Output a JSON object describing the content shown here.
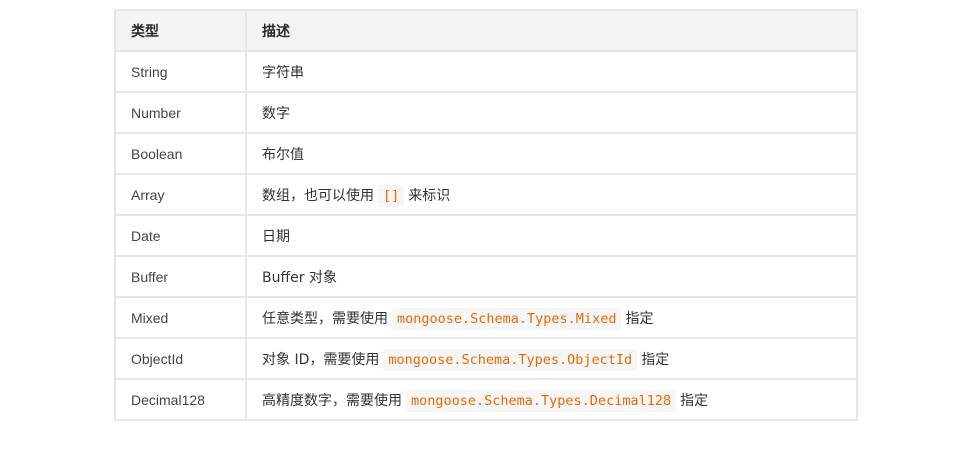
{
  "table": {
    "headers": [
      "类型",
      "描述"
    ],
    "code_color": "#e96900",
    "rows": [
      {
        "type": "String",
        "desc_pre": "字符串",
        "code": "",
        "desc_post": ""
      },
      {
        "type": "Number",
        "desc_pre": "数字",
        "code": "",
        "desc_post": ""
      },
      {
        "type": "Boolean",
        "desc_pre": "布尔值",
        "code": "",
        "desc_post": ""
      },
      {
        "type": "Array",
        "desc_pre": "数组，也可以使用",
        "code": "[]",
        "desc_post": "来标识"
      },
      {
        "type": "Date",
        "desc_pre": "日期",
        "code": "",
        "desc_post": ""
      },
      {
        "type": "Buffer",
        "desc_pre": "Buffer 对象",
        "code": "",
        "desc_post": ""
      },
      {
        "type": "Mixed",
        "desc_pre": "任意类型，需要使用",
        "code": "mongoose.Schema.Types.Mixed",
        "desc_post": "指定"
      },
      {
        "type": "ObjectId",
        "desc_pre": "对象 ID，需要使用",
        "code": "mongoose.Schema.Types.ObjectId",
        "desc_post": "指定"
      },
      {
        "type": "Decimal128",
        "desc_pre": "高精度数字，需要使用",
        "code": "mongoose.Schema.Types.Decimal128",
        "desc_post": "指定"
      }
    ]
  }
}
